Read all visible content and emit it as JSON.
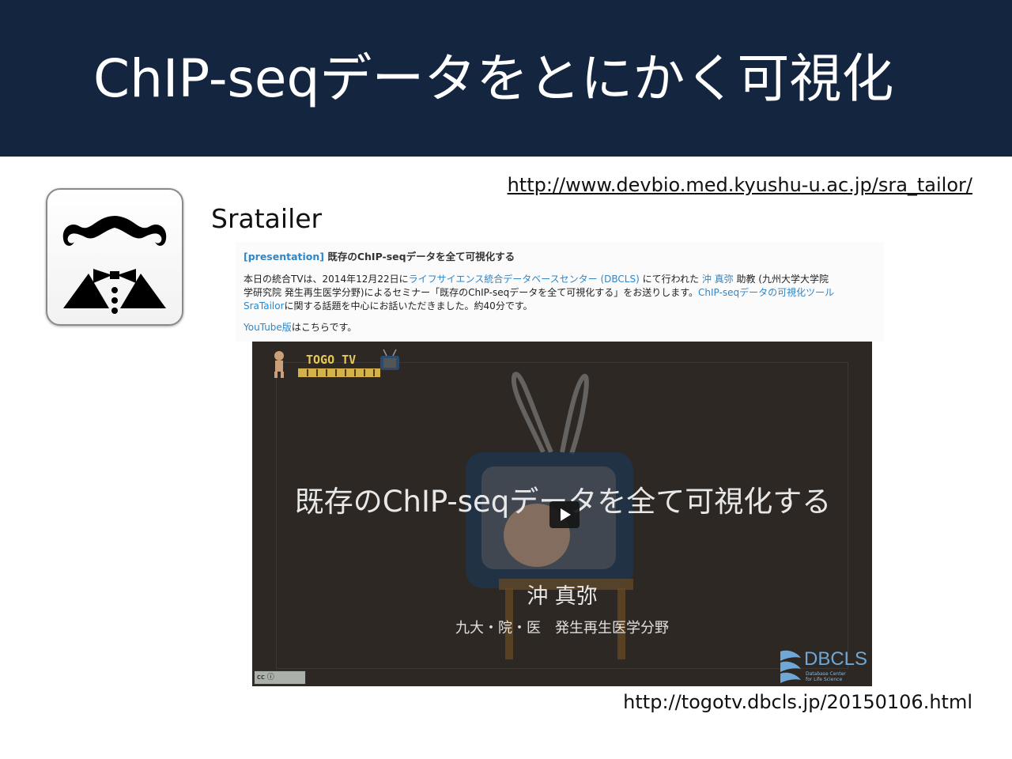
{
  "slide": {
    "title": "ChIP-seqデータをとにかく可視化",
    "url_top": "http://www.devbio.med.kyushu-u.ac.jp/sra_tailor/",
    "app_name": "Sratailer",
    "url_bottom": "http://togotv.dbcls.jp/20150106.html",
    "header_color": "#14253f"
  },
  "page_clip": {
    "tag": "[presentation]",
    "heading": " 既存のChIP-seqデータを全て可視化する",
    "p1_a": "本日の統合TVは、2014年12月22日に",
    "p1_link1": "ライフサイエンス統合データベースセンター (DBCLS)",
    "p1_b": " にて行われた ",
    "p1_link2": "沖 真弥",
    "p1_c": " 助教 (九州大学大学院",
    "p2_a": "学研究院 発生再生医学分野)によるセミナー「既存のChIP-seqデータを全て可視化する」をお送りします。",
    "p2_link": "ChIP-seqデータの可視化ツール",
    "p3_link": "SraTailor",
    "p3_a": "に関する話題を中心にお話いただきました。約40分です。",
    "p4_link": "YouTube版",
    "p4_a": "はこちらです。"
  },
  "video": {
    "logo_text": "TOGO TV",
    "title": "既存のChIP-seqデータを全て可視化する",
    "speaker": "沖 真弥",
    "affiliation": "九大・院・医　発生再生医学分野",
    "cc_label": "cc  ⓘ",
    "org_logo": "DBCLS",
    "org_sub1": "Database Center",
    "org_sub2": "for Life Science"
  },
  "icons": {
    "app_icon": "mustache-tuxedo-icon",
    "play": "play-icon",
    "link_color": "#2f86c8"
  }
}
